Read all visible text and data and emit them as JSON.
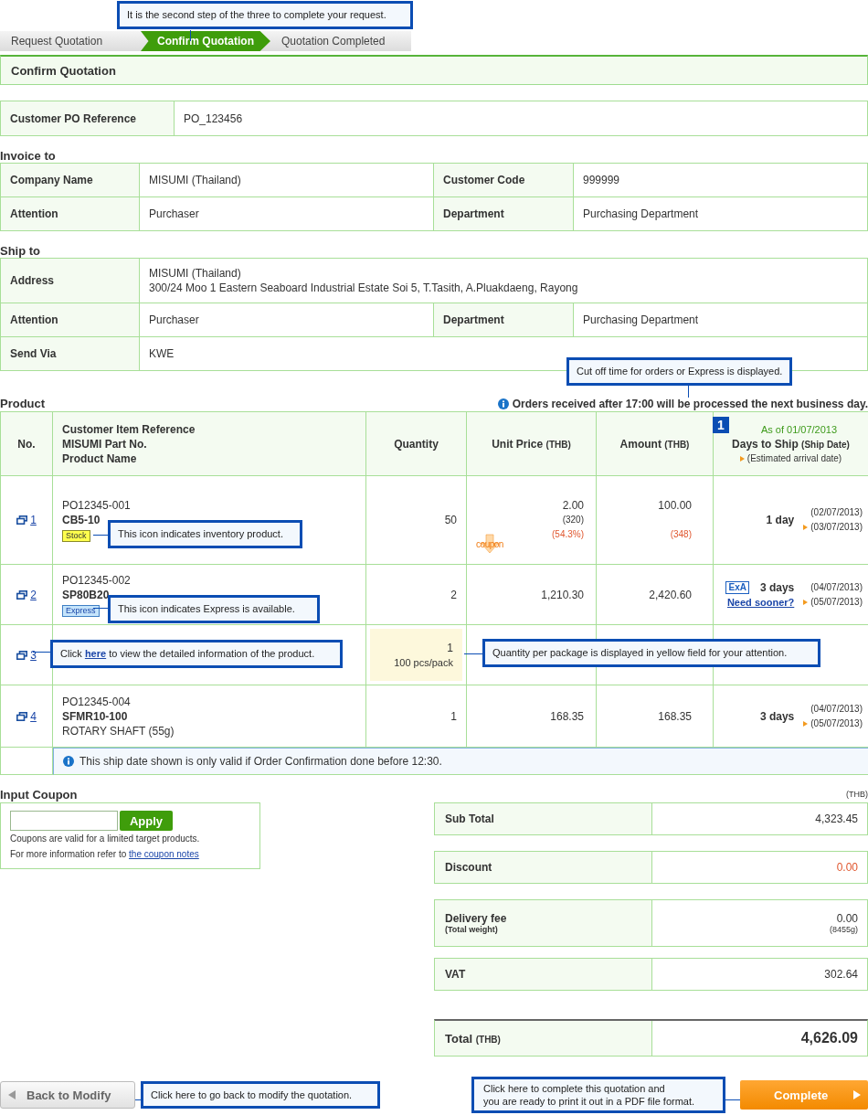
{
  "steps": [
    {
      "label": "Request Quotation",
      "selected": false
    },
    {
      "label": "Confirm Quotation",
      "selected": true
    },
    {
      "label": "Quotation Completed",
      "selected": false
    }
  ],
  "steps_callout": "It is the second step of the three to complete your request.",
  "page_title": "Confirm Quotation",
  "po": {
    "label": "Customer PO Reference",
    "value": "PO_123456"
  },
  "invoice": {
    "title": "Invoice to",
    "fields": [
      {
        "label": "Company Name",
        "value": "MISUMI (Thailand)"
      },
      {
        "label": "Customer Code",
        "value": "999999"
      },
      {
        "label": "Attention",
        "value": "Purchaser"
      },
      {
        "label": "Department",
        "value": "Purchasing Department"
      }
    ]
  },
  "ship": {
    "title": "Ship to",
    "address": {
      "label": "Address",
      "lines": [
        "MISUMI (Thailand)",
        "300/24 Moo 1 Eastern Seaboard Industrial Estate Soi 5, T.Tasith, A.Pluakdaeng, Rayong"
      ]
    },
    "fields": [
      {
        "label": "Attention",
        "value": "Purchaser"
      },
      {
        "label": "Department",
        "value": "Purchasing Department"
      }
    ],
    "send_via": {
      "label": "Send Via",
      "value": "KWE"
    }
  },
  "product": {
    "title": "Product",
    "notice": "Orders received after 17:00 will be processed the next business day.",
    "notice_callout": "Cut off time for orders or Express is displayed.",
    "columns": {
      "no": "No.",
      "item": [
        "Customer Item Reference",
        "MISUMI Part No.",
        "Product Name"
      ],
      "quantity": "Quantity",
      "unit_price": "Unit Price",
      "amount": "Amount",
      "unit_price_currency": "(THB)",
      "amount_currency": "(THB)"
    },
    "days_header": {
      "marker": "1",
      "as_of": "As of 01/07/2013",
      "label": "Days to Ship",
      "sub": "(Ship Date)",
      "arrival": "(Estimated arrival date)"
    },
    "rows": [
      {
        "no": "1",
        "ref": "PO12345-001",
        "part": "CB5-10",
        "badge": {
          "kind": "stock",
          "label": "Stock"
        },
        "quantity": "50",
        "price": "2.00",
        "price_sub": "(320)",
        "price_pct": "(54.3%)",
        "coupon": "coupon",
        "amount": "100.00",
        "amount_sub": "(348)",
        "days": "1 day",
        "ship_date": "(02/07/2013)",
        "arrival": "(03/07/2013)",
        "highlight": false
      },
      {
        "no": "2",
        "ref": "PO12345-002",
        "part": "SP80B20",
        "badge": {
          "kind": "express",
          "label": "Express"
        },
        "quantity": "2",
        "price": "1,210.30",
        "amount": "2,420.60",
        "express_mark": "ExA",
        "days": "3 days",
        "sooner": "Need sooner?",
        "ship_date": "(04/07/2013)",
        "arrival": "(05/07/2013)",
        "highlight": false
      },
      {
        "no": "3",
        "quantity": "1",
        "pack": "100 pcs/pack",
        "highlight": true
      },
      {
        "no": "4",
        "ref": "PO12345-004",
        "part": "SFMR10-100",
        "name": "ROTARY SHAFT (55g)",
        "quantity": "1",
        "price": "168.35",
        "amount": "168.35",
        "days": "3 days",
        "ship_date": "(04/07/2013)",
        "arrival": "(05/07/2013)",
        "highlight": false
      }
    ],
    "note": "This ship date shown is only valid if Order Confirmation done before 12:30.",
    "callouts": {
      "stock": "This icon indicates inventory product.",
      "express": "This icon indicates Express is available.",
      "detail": {
        "before": "Click ",
        "link": "here",
        "after": " to view the detailed information of the product."
      },
      "package": "Quantity per package is displayed in yellow field for your attention."
    }
  },
  "coupon": {
    "title": "Input Coupon",
    "button": "Apply",
    "note": "Coupons are valid for a limited target products.",
    "more": "For more information refer to ",
    "link": "the coupon notes"
  },
  "totals": {
    "currency": "(THB)",
    "rows": [
      {
        "kind": "plain",
        "label": "Sub Total",
        "value": "4,323.45"
      },
      {
        "kind": "discount",
        "label": "Discount",
        "value": "0.00"
      },
      {
        "kind": "weight",
        "label": "Delivery fee",
        "sub": "(Total weight)",
        "value": "0.00",
        "value_sub": "(8455g)"
      },
      {
        "kind": "plain",
        "label": "VAT",
        "value": "302.64"
      },
      {
        "kind": "total",
        "label": "Total",
        "sub": "(THB)",
        "value": "4,626.09"
      }
    ]
  },
  "back": {
    "label": "Back to Modify",
    "callout": "Click here to go back to modify the quotation."
  },
  "complete": {
    "label": "Complete",
    "callout": [
      "Click here to complete this quotation and",
      "you are ready to print it out in a PDF file format."
    ]
  }
}
